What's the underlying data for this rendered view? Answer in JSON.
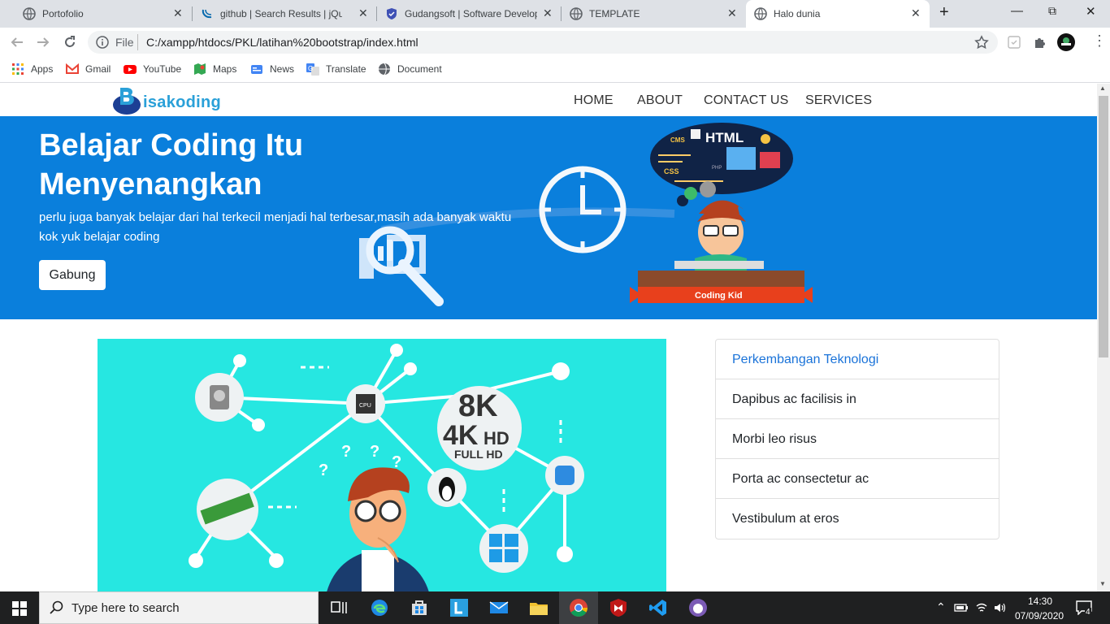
{
  "browser": {
    "tabs": [
      {
        "title": "Portofolio",
        "icon": "globe-icon"
      },
      {
        "title": "github | Search Results | jQuery",
        "icon": "jquery-icon"
      },
      {
        "title": "Gudangsoft | Software Develop",
        "icon": "shield-icon"
      },
      {
        "title": "TEMPLATE",
        "icon": "globe-icon"
      },
      {
        "title": "Halo dunia",
        "icon": "globe-icon",
        "active": true
      }
    ],
    "new_tab": "+",
    "url_scheme": "File",
    "url": "C:/xampp/htdocs/PKL/latihan%20bootstrap/index.html",
    "bookmarks": [
      "Apps",
      "Gmail",
      "YouTube",
      "Maps",
      "News",
      "Translate",
      "Document"
    ]
  },
  "site": {
    "logo_text": "isakoding",
    "nav": [
      "HOME",
      "ABOUT",
      "CONTACT US",
      "SERVICES"
    ],
    "hero": {
      "title": "Belajar Coding Itu Menyenangkan",
      "subtitle": "perlu juga banyak belajar dari hal terkecil menjadi hal terbesar,masih ada banyak waktu kok yuk belajar coding",
      "button": "Gabung",
      "illus_labels": {
        "html": "HTML",
        "css": "CSS",
        "cms": "CMS",
        "php": "PHP",
        "kid": "Coding Kid"
      }
    },
    "tech_labels": {
      "k8": "8K",
      "k4": "4K",
      "hd": "HD",
      "fullhd": "FULL HD",
      "cpu": "CPU"
    },
    "list": [
      {
        "label": "Perkembangan Teknologi",
        "active": true
      },
      {
        "label": "Dapibus ac facilisis in"
      },
      {
        "label": "Morbi leo risus"
      },
      {
        "label": "Porta ac consectetur ac"
      },
      {
        "label": "Vestibulum at eros"
      }
    ]
  },
  "taskbar": {
    "search_placeholder": "Type here to search",
    "time": "14:30",
    "date": "07/09/2020",
    "notification_count": "4"
  },
  "colors": {
    "hero_bg": "#0a7fdc",
    "illus_bg": "#26e7e1",
    "link_active": "#1a73d9"
  }
}
